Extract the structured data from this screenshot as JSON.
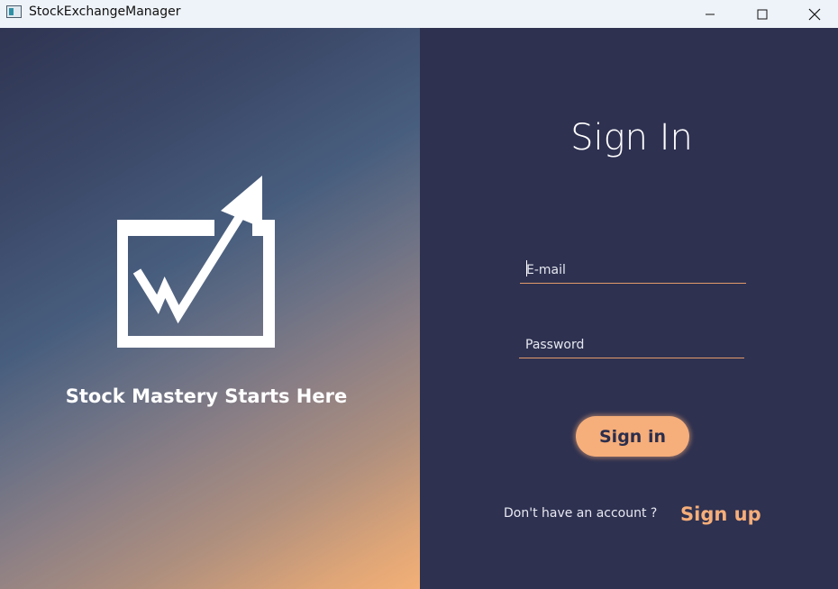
{
  "window": {
    "title": "StockExchangeManager",
    "buttons": {
      "minimize": "minimize-icon",
      "maximize": "maximize-icon",
      "close": "close-icon"
    }
  },
  "left_panel": {
    "logo": "chart-arrow-icon",
    "tagline": "Stock Mastery Starts Here"
  },
  "form": {
    "title": "Sign In",
    "email_placeholder": "E-mail",
    "password_placeholder": "Password",
    "signin_label": "Sign in",
    "no_account_text": "Don't have an account ?",
    "signup_label": "Sign up"
  },
  "colors": {
    "panel_bg": "#2e3150",
    "accent": "#f6ae7a",
    "input_underline": "#e39a6a",
    "titlebar_bg": "#eef3f9"
  }
}
